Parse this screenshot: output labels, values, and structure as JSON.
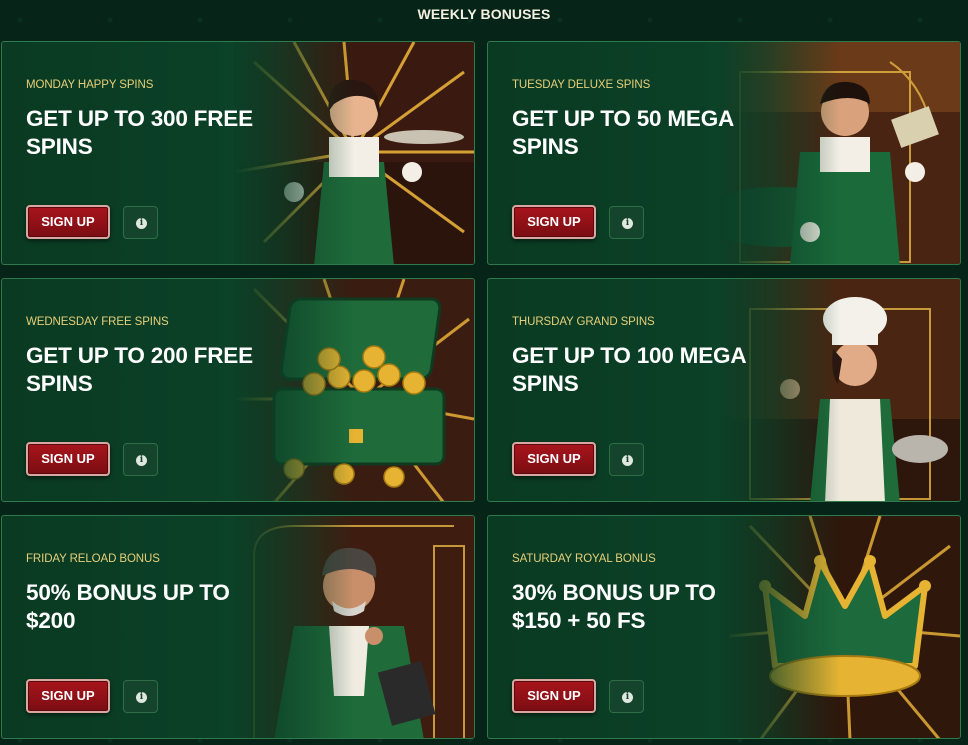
{
  "header": {
    "title": "WEEKLY BONUSES"
  },
  "cards": [
    {
      "subtitle": "MONDAY HAPPY SPINS",
      "title": "GET UP TO 300 FREE SPINS",
      "button": "SIGN UP",
      "info_icon": "info-icon",
      "art": "waitress-with-tray"
    },
    {
      "subtitle": "TUESDAY DELUXE SPINS",
      "title": "GET UP TO 50 MEGA SPINS",
      "button": "SIGN UP",
      "info_icon": "info-icon",
      "art": "croupier-with-cash"
    },
    {
      "subtitle": "WEDNESDAY FREE SPINS",
      "title": "GET UP TO 200 FREE SPINS",
      "button": "SIGN UP",
      "info_icon": "info-icon",
      "art": "briefcase-of-coins"
    },
    {
      "subtitle": "THURSDAY GRAND SPINS",
      "title": "GET UP TO 100 MEGA SPINS",
      "button": "SIGN UP",
      "info_icon": "info-icon",
      "art": "chef-with-bowl"
    },
    {
      "subtitle": "FRIDAY RELOAD BONUS",
      "title": "50% BONUS UP TO $200",
      "button": "SIGN UP",
      "info_icon": "info-icon",
      "art": "gentleman-with-pen"
    },
    {
      "subtitle": "SATURDAY ROYAL BONUS",
      "title": "30% BONUS UP TO $150 + 50 FS",
      "button": "SIGN UP",
      "info_icon": "info-icon",
      "art": "golden-crown"
    }
  ],
  "colors": {
    "background": "#062417",
    "card": "#0b4027",
    "card_border": "#2f7a4d",
    "subtitle": "#e6cf7a",
    "signup_button": "#9b1219",
    "info_button": "#14442c"
  }
}
